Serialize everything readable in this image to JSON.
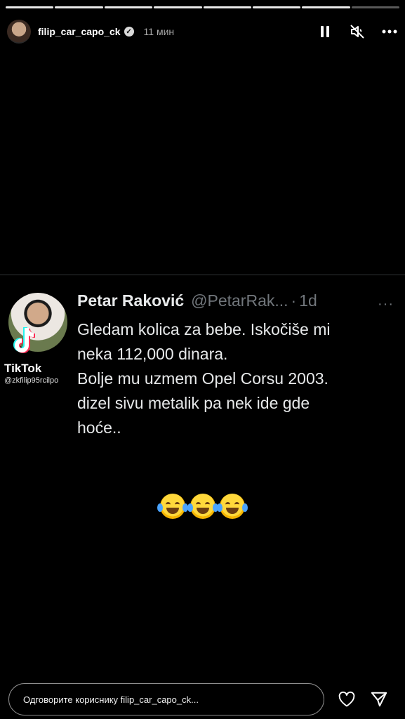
{
  "story": {
    "progress_segments": 7,
    "active_segment": 7,
    "username": "filip_car_capo_ck",
    "verified": true,
    "time_ago": "11 мин"
  },
  "header_icons": [
    "pause-icon",
    "mute-icon",
    "more-icon"
  ],
  "tweet": {
    "name": "Petar Raković",
    "handle": "@PetarRak...",
    "dot": "·",
    "ago": "1d",
    "more": "···",
    "lines": [
      "Gledam kolica za bebe. Iskočiše mi",
      "neka 112,000 dinara.",
      "Bolje mu uzmem Opel Corsu 2003.",
      "dizel sivu metalik pa nek ide gde",
      "hoće.."
    ]
  },
  "watermark": {
    "label": "TikTok",
    "handle": "@zkfilip95rcilpo"
  },
  "emoji_icons": [
    "joy-emoji-icon",
    "joy-emoji-icon",
    "joy-emoji-icon"
  ],
  "reply": {
    "placeholder": "Одговорите кориснику filip_car_capo_ck..."
  },
  "colors": {
    "background": "#000000",
    "tweet_text": "#e7e9ea",
    "secondary": "#71767b"
  }
}
